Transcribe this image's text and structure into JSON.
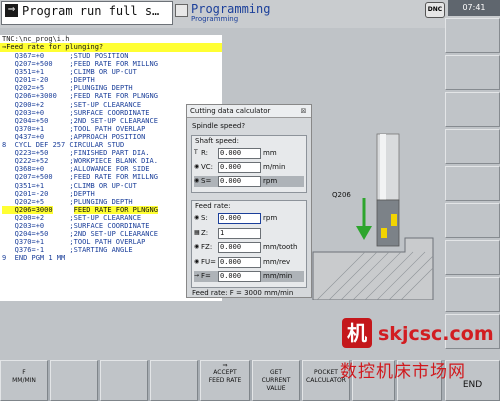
{
  "header": {
    "mode1_label": "Program run full s…",
    "mode2_label": "Programming",
    "mode2_sub": "Programming",
    "dnc": "DNC",
    "time": "07:41"
  },
  "listing": {
    "path": "TNC:\\nc_prog\\i.h",
    "prompt": "Feed rate for plunging?",
    "rows": [
      "   Q367=+0      ;STUD POSITION",
      "   Q207=+500    ;FEED RATE FOR MILLNG",
      "   Q351=+1      ;CLIMB OR UP-CUT",
      "   Q201=-20     ;DEPTH",
      "   Q202=+5      ;PLUNGING DEPTH",
      "   Q206=+3000   ;FEED RATE FOR PLNGNG",
      "   Q200=+2      ;SET-UP CLEARANCE",
      "   Q203=+0      ;SURFACE COORDINATE",
      "   Q204=+50     ;2ND SET-UP CLEARANCE",
      "   Q370=+1      ;TOOL PATH OVERLAP",
      "   Q437=+0      ;APPROACH POSITION",
      "8  CYCL DEF 257 CIRCULAR STUD",
      "   Q223=+50     ;FINISHED PART DIA.",
      "   Q222=+52     ;WORKPIECE BLANK DIA.",
      "   Q368=+0      ;ALLOWANCE FOR SIDE",
      "   Q207=+500    ;FEED RATE FOR MILLNG",
      "   Q351=+1      ;CLIMB OR UP-CUT",
      "   Q201=-20     ;DEPTH",
      "   Q202=+5      ;PLUNGING DEPTH",
      "   Q206=3000",
      "   Q200=+2      ;SET-UP CLEARANCE",
      "   Q203=+0      ;SURFACE COORDINATE",
      "   Q204=+50     ;2ND SET-UP CLEARANCE",
      "   Q370=+1      ;TOOL PATH OVERLAP",
      "   Q376=-1      ;STARTING ANGLE",
      "9  END PGM 1 MM"
    ],
    "edit_row_comment": "FEED RATE FOR PLNGNG"
  },
  "graphic": {
    "label": "Q206"
  },
  "calculator": {
    "title": "Cutting data calculator",
    "question": "Spindle speed?",
    "shaft_title": "Shaft speed:",
    "shaft": [
      {
        "icon": "T",
        "label": "R:",
        "value": "0.000",
        "unit": "mm"
      },
      {
        "icon": "◉",
        "label": "VC:",
        "value": "0.000",
        "unit": "m/min"
      },
      {
        "icon": "◉",
        "label": "S=",
        "value": "0.000",
        "unit": "rpm"
      }
    ],
    "feed_title": "Feed rate:",
    "feed": [
      {
        "icon": "◉",
        "label": "S:",
        "value": "0.000",
        "unit": "rpm"
      },
      {
        "icon": "▦",
        "label": "Z:",
        "value": "1",
        "unit": ""
      },
      {
        "icon": "◉",
        "label": "FZ:",
        "value": "0.000",
        "unit": "mm/tooth"
      },
      {
        "icon": "◉",
        "label": "FU=",
        "value": "0.000",
        "unit": "mm/rev"
      },
      {
        "icon": "→",
        "label": "F=",
        "value": "0.000",
        "unit": "mm/min"
      }
    ],
    "result": "Feed rate: F = 3000 mm/min"
  },
  "softkeys": {
    "sk1": "F\nMM/MIN",
    "sk5": "ACCEPT\nFEED RATE",
    "sk6": "GET\nCURRENT\nVALUE",
    "sk7": "POCKET\nCALCULATOR",
    "end": "END"
  },
  "watermark": {
    "logo": "机",
    "url": "skjcsc.com",
    "cn": "数控机床市场网"
  },
  "colors": {
    "accent_blue": "#1b3f9a",
    "highlight_yellow": "#ffff33",
    "arrow_green": "#2da52d",
    "watermark_red": "#d21d21"
  }
}
